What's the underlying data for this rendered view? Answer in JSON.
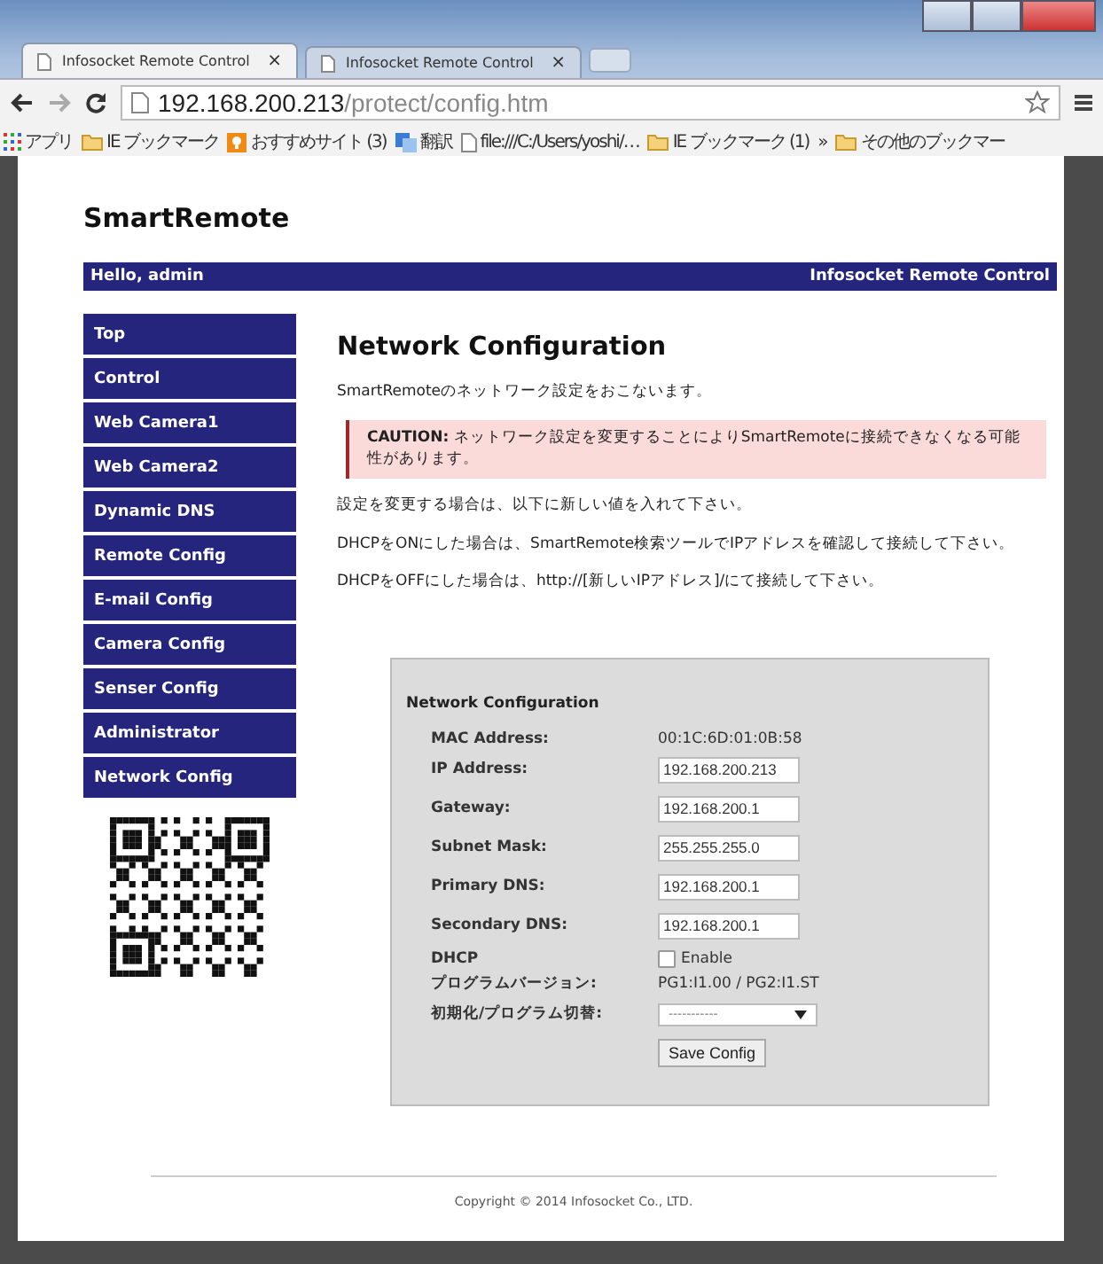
{
  "browser": {
    "tabs": [
      {
        "title": "Infosocket Remote Control",
        "close": "×",
        "selected": true
      },
      {
        "title": "Infosocket Remote Control",
        "close": "×",
        "selected": false
      }
    ],
    "address": {
      "host": "192.168.200.213",
      "path": "/protect/config.htm"
    },
    "bookmarks": [
      {
        "kind": "apps",
        "label": "アプリ"
      },
      {
        "kind": "folder",
        "label": "IE ブックマーク"
      },
      {
        "kind": "site",
        "label": "おすすめサイト (3)"
      },
      {
        "kind": "translate",
        "label": "翻訳"
      },
      {
        "kind": "file",
        "label": "file:///C:/Users/yoshi/…"
      },
      {
        "kind": "folder",
        "label": "IE ブックマーク (1)"
      },
      {
        "kind": "more",
        "label": "»"
      },
      {
        "kind": "folder",
        "label": "その他のブックマー"
      }
    ]
  },
  "page": {
    "logo": "SmartRemote",
    "header": {
      "greeting": "Hello, admin",
      "title": "Infosocket Remote Control"
    },
    "nav": [
      "Top",
      "Control",
      "Web Camera1",
      "Web Camera2",
      "Dynamic DNS",
      "Remote Config",
      "E-mail Config",
      "Camera Config",
      "Senser Config",
      "Administrator",
      "Network Config"
    ],
    "heading": "Network Configuration",
    "intro": "SmartRemoteのネットワーク設定をおこないます。",
    "caution": "**CAUTION:** ネットワーク設定を変更することによりSmartRemoteに接続できなくなる可能性があります。",
    "paragraphs": [
      "設定を変更する場合は、以下に新しい値を入れて下さい。",
      "DHCPをONにした場合は、SmartRemote検索ツールでIPアドレスを確認して接続して下さい。",
      "DHCPをOFFにした場合は、http://[新しいIPアドレス]/にて接続して下さい。"
    ],
    "form": {
      "title": "Network Configuration",
      "rows": [
        {
          "kind": "text",
          "label": "MAC Address:",
          "value": "00:1C:6D:01:0B:58"
        },
        {
          "kind": "input",
          "label": "IP Address:",
          "value": "192.168.200.213"
        },
        {
          "kind": "input",
          "label": "Gateway:",
          "value": "192.168.200.1"
        },
        {
          "kind": "input",
          "label": "Subnet Mask:",
          "value": "255.255.255.0"
        },
        {
          "kind": "input",
          "label": "Primary DNS:",
          "value": "192.168.200.1"
        },
        {
          "kind": "input",
          "label": "Secondary DNS:",
          "value": "192.168.200.1"
        },
        {
          "kind": "checkbox",
          "label": "DHCP",
          "value": "Enable",
          "checked": false
        },
        {
          "kind": "text",
          "label": "プログラムバージョン:",
          "value": "PG1:I1.00 / PG2:I1.ST"
        },
        {
          "kind": "select",
          "label": "初期化/プログラム切替:",
          "value": "-----------"
        },
        {
          "kind": "button",
          "value": "Save Config"
        }
      ]
    },
    "footer": "Copyright © 2014 Infosocket Co., LTD."
  }
}
